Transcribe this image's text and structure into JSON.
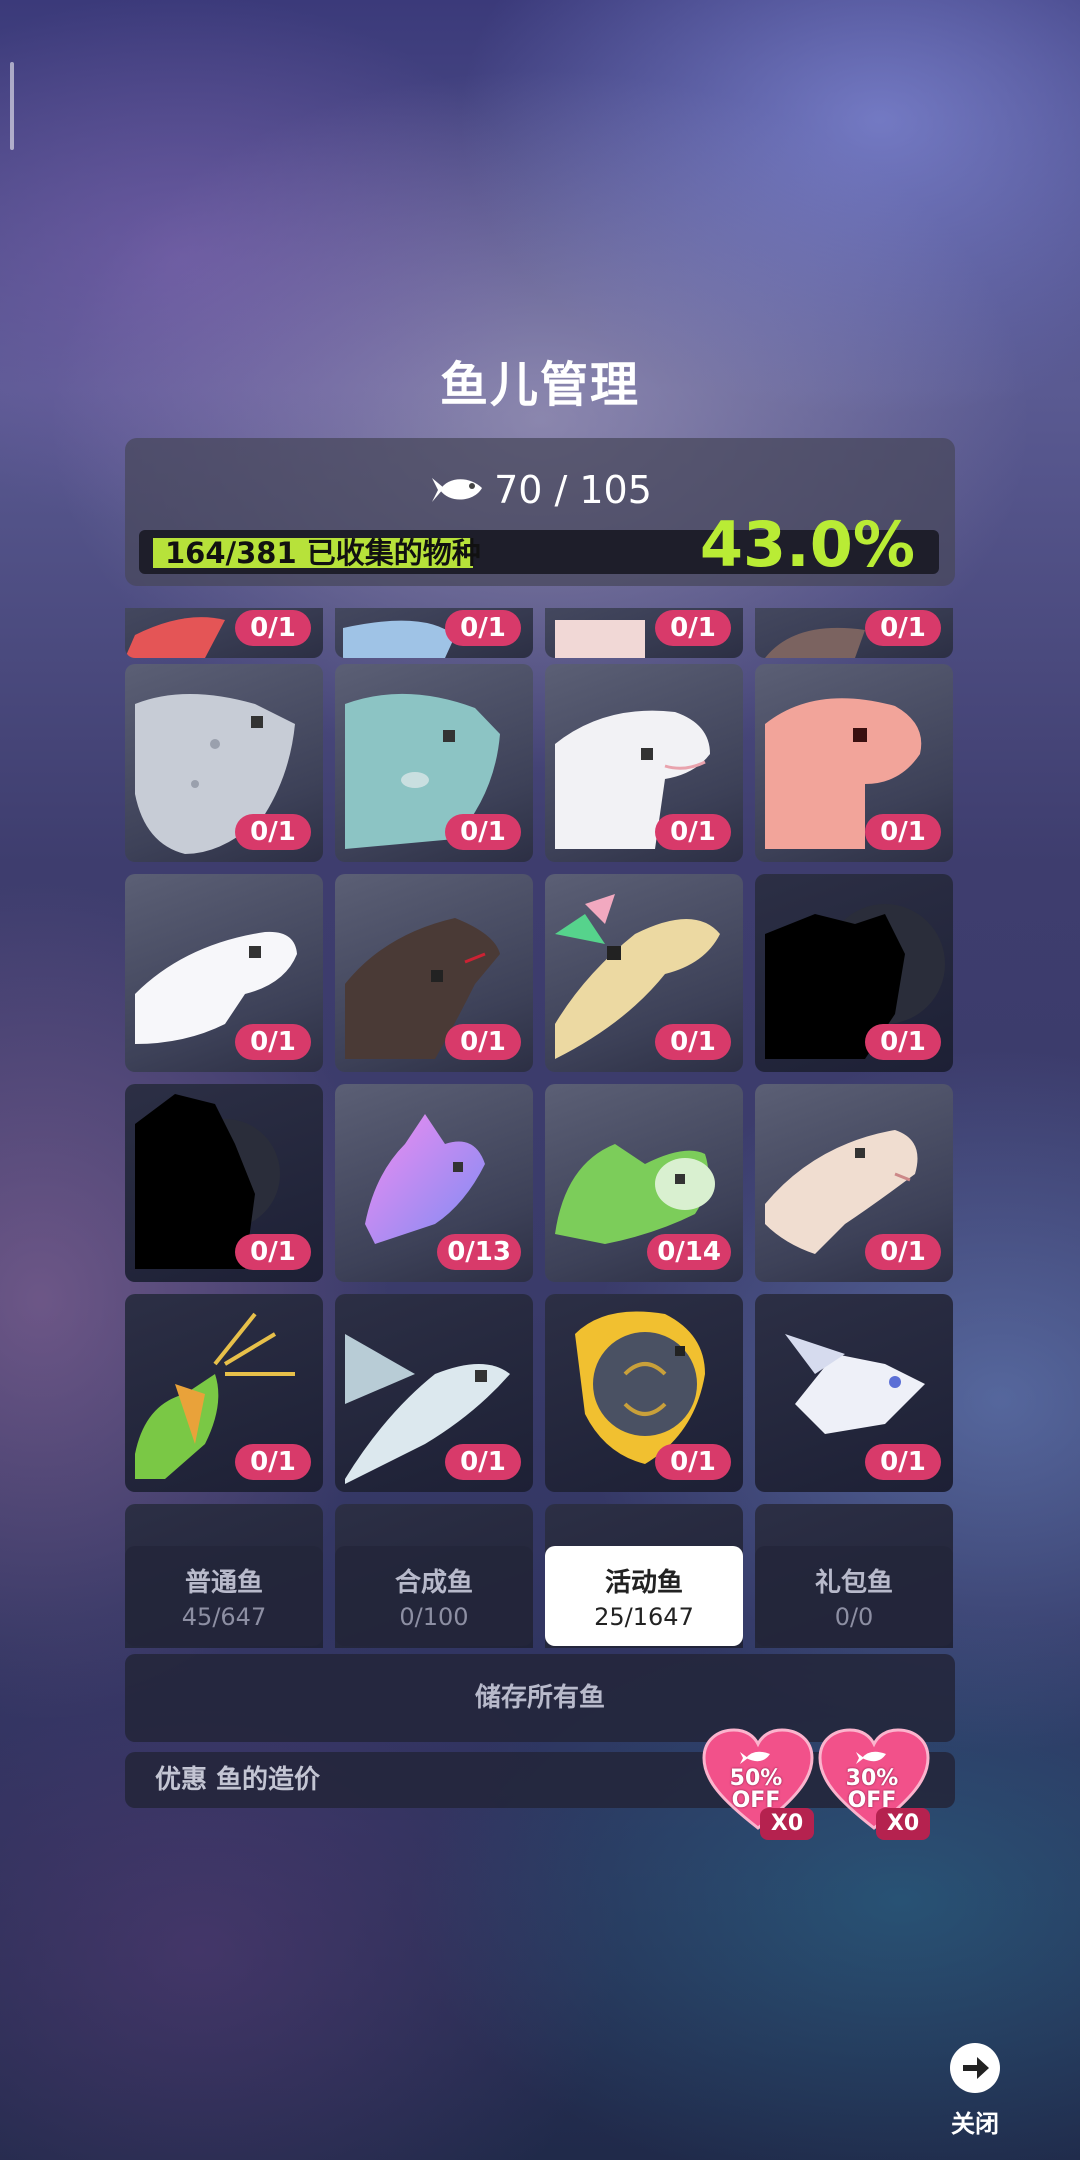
{
  "screen": {
    "title": "鱼儿管理"
  },
  "header": {
    "fish_count": "70 / 105",
    "species_text": "164/381 已收集的物种",
    "species_collected": 164,
    "species_total": 381,
    "percent": "43.0%"
  },
  "grid": {
    "badges": [
      "0/1",
      "0/1",
      "0/1",
      "0/1",
      "0/1",
      "0/1",
      "0/1",
      "0/1",
      "0/1",
      "0/1",
      "0/1",
      "0/1",
      "0/1",
      "0/13",
      "0/14",
      "0/1",
      "0/1",
      "0/1",
      "0/1",
      "0/1"
    ]
  },
  "tabs": [
    {
      "label": "普通鱼",
      "count": "45/647"
    },
    {
      "label": "合成鱼",
      "count": "0/100"
    },
    {
      "label": "活动鱼",
      "count": "25/1647"
    },
    {
      "label": "礼包鱼",
      "count": "0/0"
    }
  ],
  "store_all_label": "储存所有鱼",
  "discount": {
    "label": "优惠 鱼的造价",
    "coupons": [
      {
        "percent": "50%",
        "off": "OFF",
        "qty": "X0"
      },
      {
        "percent": "30%",
        "off": "OFF",
        "qty": "X0"
      }
    ]
  },
  "close_label": "关闭",
  "colors": {
    "accent_green": "#b9ec35",
    "badge_pink": "#d83a6a",
    "panel": "#23263a"
  }
}
